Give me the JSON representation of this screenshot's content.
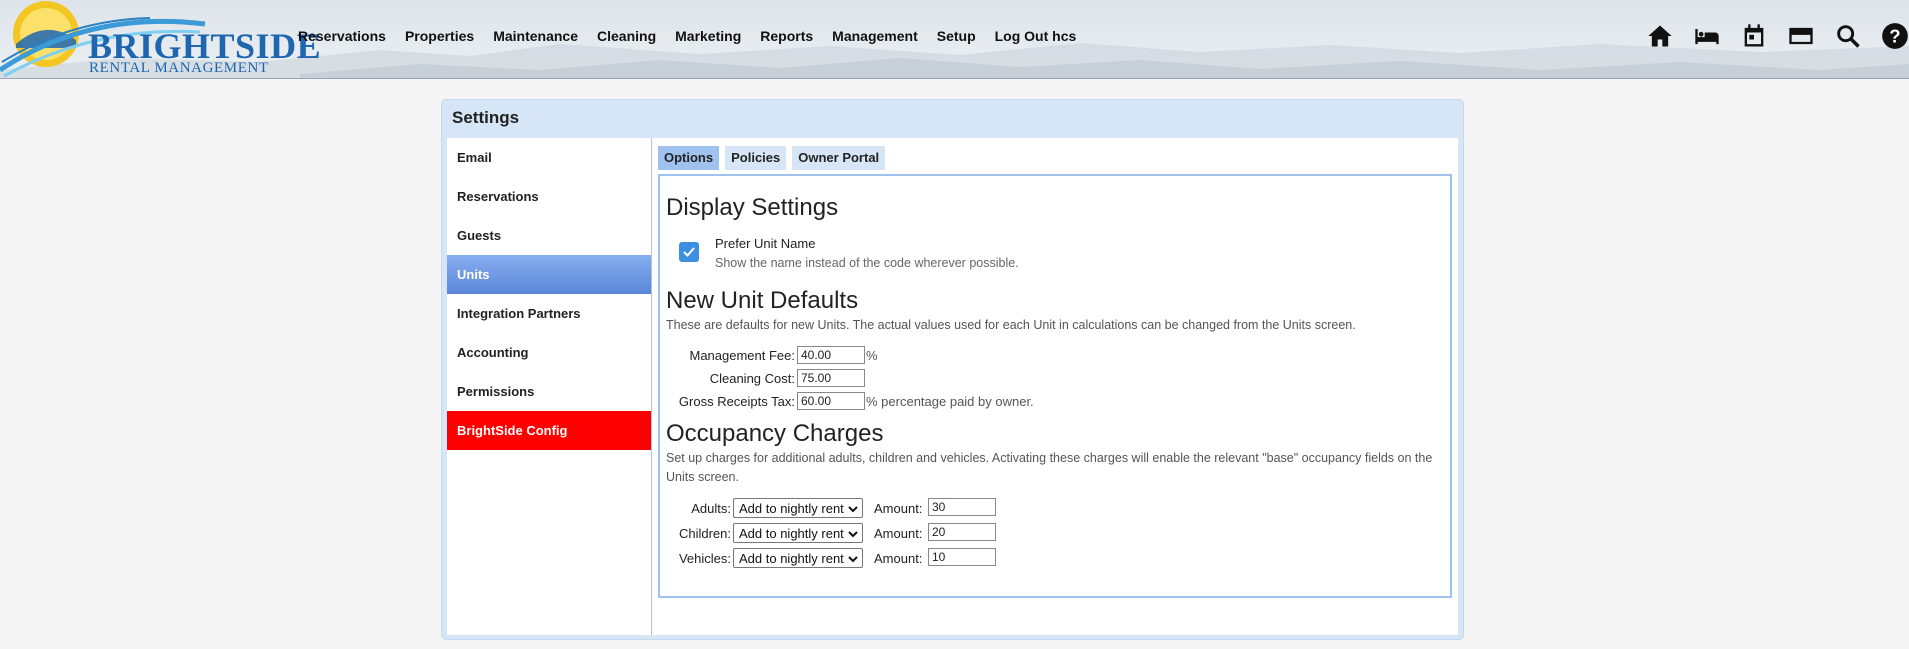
{
  "brand": {
    "name": "BRIGHTSIDE",
    "subtitle": "RENTAL MANAGEMENT"
  },
  "nav": [
    {
      "label": "Reservations"
    },
    {
      "label": "Properties"
    },
    {
      "label": "Maintenance"
    },
    {
      "label": "Cleaning"
    },
    {
      "label": "Marketing"
    },
    {
      "label": "Reports"
    },
    {
      "label": "Management"
    },
    {
      "label": "Setup"
    },
    {
      "label": "Log Out hcs"
    }
  ],
  "header_icons": [
    "home-icon",
    "bed-icon",
    "calendar-icon",
    "credit-card-icon",
    "search-icon",
    "help-icon"
  ],
  "panel": {
    "title": "Settings"
  },
  "sidebar": [
    {
      "label": "Email"
    },
    {
      "label": "Reservations"
    },
    {
      "label": "Guests"
    },
    {
      "label": "Units"
    },
    {
      "label": "Integration Partners"
    },
    {
      "label": "Accounting"
    },
    {
      "label": "Permissions"
    },
    {
      "label": "BrightSide Config"
    }
  ],
  "tabs": [
    {
      "label": "Options"
    },
    {
      "label": "Policies"
    },
    {
      "label": "Owner Portal"
    }
  ],
  "display": {
    "heading": "Display Settings",
    "prefer_label": "Prefer Unit Name",
    "prefer_hint": "Show the name instead of the code wherever possible."
  },
  "defaults": {
    "heading": "New Unit Defaults",
    "desc": "These are defaults for new Units. The actual values used for each Unit in calculations can be changed from the Units screen.",
    "mgmt_label": "Management Fee:",
    "mgmt_value": "40.00",
    "mgmt_unit": "%",
    "cleaning_label": "Cleaning Cost:",
    "cleaning_value": "75.00",
    "tax_label": "Gross Receipts Tax:",
    "tax_value": "60.00",
    "tax_unit": "% percentage paid by owner."
  },
  "occupancy": {
    "heading": "Occupancy Charges",
    "desc": "Set up charges for additional adults, children and vehicles. Activating these charges will enable the relevant \"base\" occupancy fields on the Units screen.",
    "amount_label": "Amount:",
    "rows": [
      {
        "label": "Adults:",
        "option": "Add to nightly rent",
        "amount": "30"
      },
      {
        "label": "Children:",
        "option": "Add to nightly rent",
        "amount": "20"
      },
      {
        "label": "Vehicles:",
        "option": "Add to nightly rent",
        "amount": "10"
      }
    ]
  },
  "colors": {
    "brand_blue": "#1f66b0",
    "active_item": "#5b86d8",
    "config_red": "#ff0000",
    "tab_active": "#9fc2ee"
  }
}
